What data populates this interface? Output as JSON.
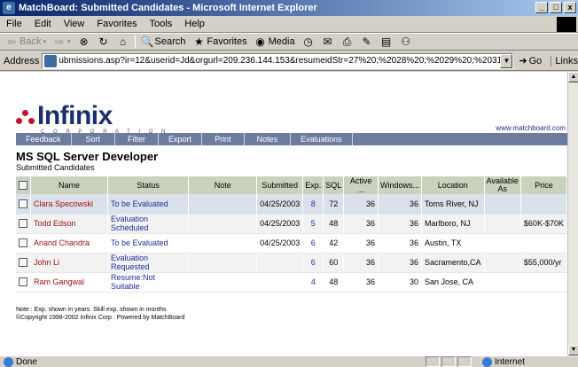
{
  "window": {
    "title": "MatchBoard: Submitted Candidates - Microsoft Internet Explorer",
    "min_icon": "minimize-icon",
    "max_icon": "maximize-icon",
    "close_icon": "close-icon"
  },
  "menu": [
    "File",
    "Edit",
    "View",
    "Favorites",
    "Tools",
    "Help"
  ],
  "toolbar": {
    "back": "Back",
    "search": "Search",
    "favorites": "Favorites",
    "media": "Media"
  },
  "address": {
    "label": "Address",
    "url": "ubmissions.asp?ir=12&userid=Jd&orgurl=209.236.144.153&resumeidStr=27%20;%2028%20;%2029%20;%2031%20;%2032;",
    "go": "Go",
    "links": "Links"
  },
  "logo": {
    "name": "Infinix",
    "sub": "C O R P O R A T I O N"
  },
  "site_link": "www.matchboard.com",
  "nav": [
    "Feedback",
    "Sort",
    "Filter",
    "Export",
    "Print",
    "Notes",
    "Evaluations"
  ],
  "page": {
    "title": "MS SQL Server Developer",
    "subtitle": "Submitted Candidates"
  },
  "table": {
    "headers": [
      "Name",
      "Status",
      "Note",
      "Submitted",
      "Exp.",
      "SQL",
      "Active ...",
      "Windows...",
      "Location",
      "Available As",
      "Price"
    ],
    "rows": [
      {
        "name": "Clara Specowski",
        "status": "To be Evaluated",
        "note": "",
        "submitted": "04/25/2003",
        "exp": "8",
        "sql": "72",
        "active": "36",
        "windows": "36",
        "location": "Toms River, NJ",
        "available": "",
        "price": ""
      },
      {
        "name": "Todd Edson",
        "status": "Evaluation Scheduled",
        "note": "",
        "submitted": "04/25/2003",
        "exp": "5",
        "sql": "48",
        "active": "36",
        "windows": "36",
        "location": "Marlboro, NJ",
        "available": "",
        "price": "$60K-$70K"
      },
      {
        "name": "Anand Chandra",
        "status": "To be Evaluated",
        "note": "",
        "submitted": "04/25/2003",
        "exp": "6",
        "sql": "42",
        "active": "36",
        "windows": "36",
        "location": "Austin, TX",
        "available": "",
        "price": ""
      },
      {
        "name": "John Li",
        "status": "Evaluation Requested",
        "note": "",
        "submitted": "",
        "exp": "6",
        "sql": "60",
        "active": "36",
        "windows": "36",
        "location": "Sacramento,CA",
        "available": "",
        "price": "$55,000/yr"
      },
      {
        "name": "Ram Gangwal",
        "status": "Resume:Not Suitable",
        "note": "",
        "submitted": "",
        "exp": "4",
        "sql": "48",
        "active": "36",
        "windows": "30",
        "location": "San Jose, CA",
        "available": "",
        "price": ""
      }
    ]
  },
  "footnote": {
    "line1": "Note : Exp. shown in years. Skill exp. shown in months",
    "line2": "©Copyright 1998-2002 Infinix Corp . Powered by MatchBoard"
  },
  "statusbar": {
    "status": "Done",
    "zone": "Internet"
  }
}
